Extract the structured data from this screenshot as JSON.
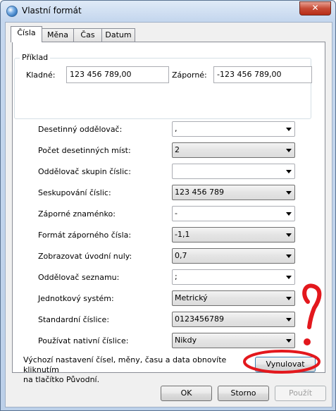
{
  "window": {
    "title": "Vlastní formát",
    "close_glyph": "✕"
  },
  "tabs": [
    {
      "label": "Čísla",
      "active": true
    },
    {
      "label": "Měna",
      "active": false
    },
    {
      "label": "Čas",
      "active": false
    },
    {
      "label": "Datum",
      "active": false
    }
  ],
  "example": {
    "legend": "Příklad",
    "positive_label": "Kladné:",
    "positive_value": "123 456 789,00",
    "negative_label": "Záporné:",
    "negative_value": "-123 456 789,00"
  },
  "settings": [
    {
      "label": "Desetinný oddělovač:",
      "value": ",",
      "editable": true
    },
    {
      "label": "Počet desetinných míst:",
      "value": "2",
      "editable": false
    },
    {
      "label": "Oddělovač skupin číslic:",
      "value": "",
      "editable": true
    },
    {
      "label": "Seskupování číslic:",
      "value": "123 456 789",
      "editable": false
    },
    {
      "label": "Záporné znaménko:",
      "value": "-",
      "editable": true
    },
    {
      "label": "Formát záporného čísla:",
      "value": "-1,1",
      "editable": false
    },
    {
      "label": "Zobrazovat úvodní nuly:",
      "value": "0,7",
      "editable": false
    },
    {
      "label": "Oddělovač seznamu:",
      "value": ";",
      "editable": true
    },
    {
      "label": "Jednotkový systém:",
      "value": "Metrický",
      "editable": false
    },
    {
      "label": "Standardní číslice:",
      "value": "0123456789",
      "editable": false
    },
    {
      "label": "Používat nativní číslice:",
      "value": "Nikdy",
      "editable": false
    }
  ],
  "info": {
    "line1": "Výchozí nastavení čísel, měny, času a data obnovíte kliknutím",
    "line2": "na tlačítko Původní.",
    "reset_label": "Vynulovat"
  },
  "buttons": {
    "ok": "OK",
    "cancel": "Storno",
    "apply": "Použít"
  },
  "colors": {
    "annotation_red": "#e3181d",
    "close_red": "#c74b36",
    "title_blue": "#c5d7ee"
  }
}
